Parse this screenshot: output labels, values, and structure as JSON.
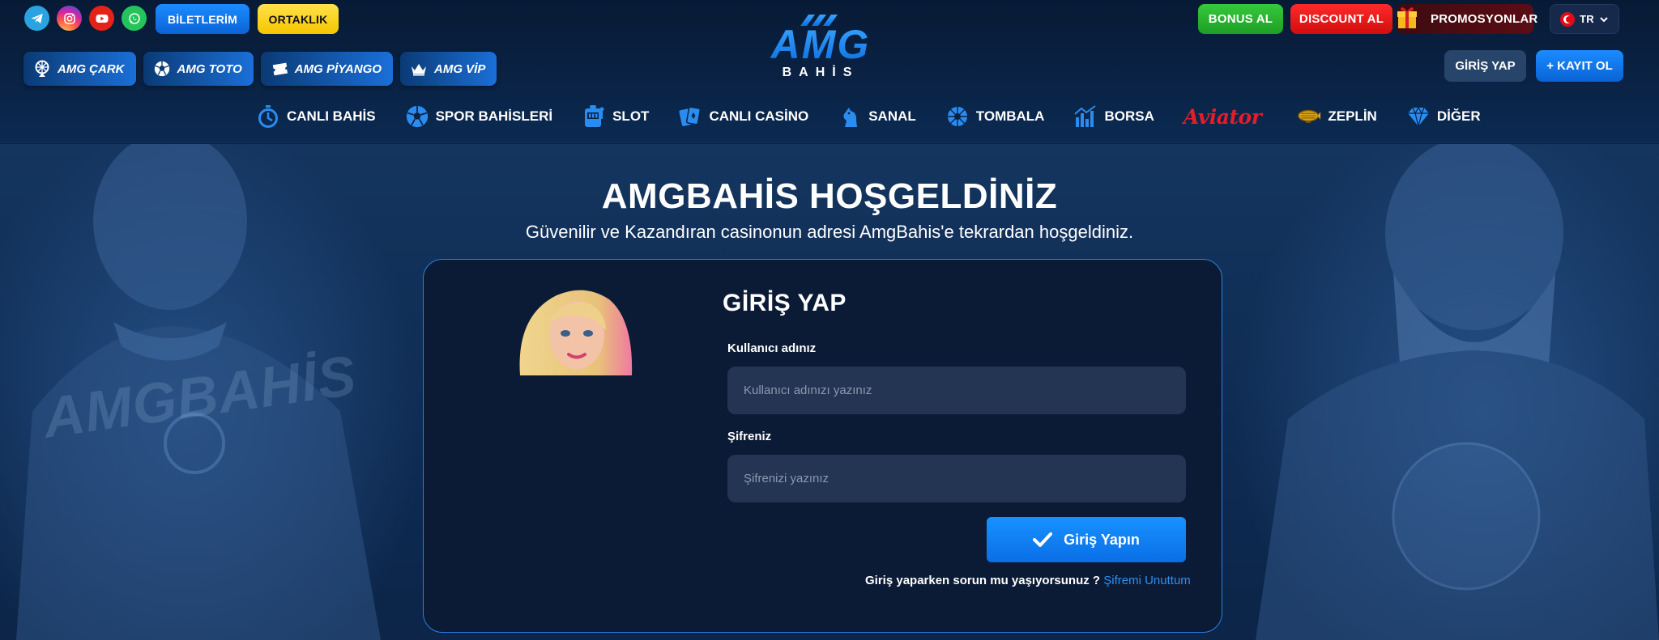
{
  "header": {
    "social": [
      {
        "name": "telegram-icon",
        "color": "#2aa3e0"
      },
      {
        "name": "instagram-icon",
        "color": "#d6249f"
      },
      {
        "name": "youtube-icon",
        "color": "#e62117"
      },
      {
        "name": "whatsapp-icon",
        "color": "#25c35b"
      }
    ],
    "biletlerim_label": "BİLETLERİM",
    "ortaklik_label": "ORTAKLIK",
    "logo_main": "AMG",
    "logo_sub": "BAHİS",
    "bonus_label": "BONUS AL",
    "discount_label": "DISCOUNT AL",
    "promo_label": "PROMOSYONLAR",
    "language": "TR",
    "sub_nav": [
      {
        "label": "AMG ÇARK",
        "icon": "wheel-icon"
      },
      {
        "label": "AMG TOTO",
        "icon": "soccer-ball-icon"
      },
      {
        "label": "AMG PİYANGO",
        "icon": "ticket-icon"
      },
      {
        "label": "AMG VİP",
        "icon": "crown-icon"
      }
    ],
    "login_label": "GİRİŞ YAP",
    "register_label": "+ KAYIT OL",
    "main_nav": [
      {
        "label": "CANLI BAHİS",
        "icon": "stopwatch-icon"
      },
      {
        "label": "SPOR BAHİSLERİ",
        "icon": "soccer-ball-icon"
      },
      {
        "label": "SLOT",
        "icon": "slot-machine-icon"
      },
      {
        "label": "CANLI CASİNO",
        "icon": "playing-cards-icon"
      },
      {
        "label": "SANAL",
        "icon": "chess-knight-icon"
      },
      {
        "label": "TOMBALA",
        "icon": "lottery-ball-icon"
      },
      {
        "label": "BORSA",
        "icon": "bar-chart-icon"
      },
      {
        "label": "Aviator",
        "icon": "aviator-logo"
      },
      {
        "label": "ZEPLİN",
        "icon": "zeppelin-icon"
      },
      {
        "label": "DİĞER",
        "icon": "diamond-icon"
      }
    ]
  },
  "hero": {
    "title": "AMGBAHİS HOŞGELDİNİZ",
    "subtitle": "Güvenilir ve Kazandıran casinonun adresi AmgBahis'e tekrardan hoşgeldiniz."
  },
  "login": {
    "title": "GİRİŞ YAP",
    "username_label": "Kullanıcı adınız",
    "username_placeholder": "Kullanıcı adınızı yazınız",
    "username_value": "",
    "password_label": "Şifreniz",
    "password_placeholder": "Şifrenizi yazınız",
    "password_value": "",
    "submit_label": "Giriş Yapın",
    "help_text": "Giriş yaparken sorun mu yaşıyorsunuz ?",
    "forgot_label": "Şifremi Unuttum"
  },
  "colors": {
    "accent": "#1b8cff",
    "header_bg": "#071a35",
    "card_bg": "#0c1b35",
    "card_border": "#2c7ee0",
    "ortaklik": "#ffe24a",
    "bonus": "#35c93c",
    "discount": "#ff2a2a",
    "link": "#2d8ff2"
  }
}
